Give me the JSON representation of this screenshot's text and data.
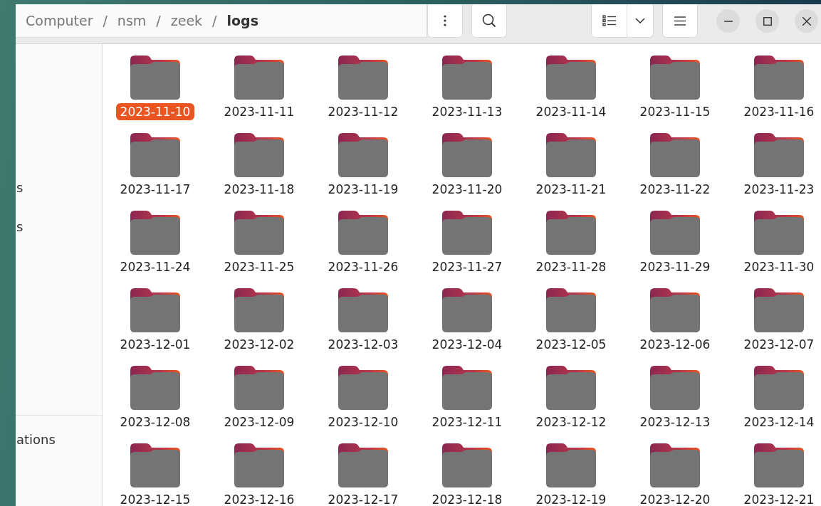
{
  "path": [
    {
      "label": "Computer",
      "current": false
    },
    {
      "label": "nsm",
      "current": false
    },
    {
      "label": "zeek",
      "current": false
    },
    {
      "label": "logs",
      "current": true
    }
  ],
  "path_separator": "/",
  "sidebar": {
    "items": [
      {
        "label": "s"
      },
      {
        "label": "s"
      }
    ],
    "other_items": [
      {
        "label": "ations"
      }
    ]
  },
  "folders": [
    {
      "name": "2023-11-10",
      "selected": true
    },
    {
      "name": "2023-11-11",
      "selected": false
    },
    {
      "name": "2023-11-12",
      "selected": false
    },
    {
      "name": "2023-11-13",
      "selected": false
    },
    {
      "name": "2023-11-14",
      "selected": false
    },
    {
      "name": "2023-11-15",
      "selected": false
    },
    {
      "name": "2023-11-16",
      "selected": false
    },
    {
      "name": "2023-11-17",
      "selected": false
    },
    {
      "name": "2023-11-18",
      "selected": false
    },
    {
      "name": "2023-11-19",
      "selected": false
    },
    {
      "name": "2023-11-20",
      "selected": false
    },
    {
      "name": "2023-11-21",
      "selected": false
    },
    {
      "name": "2023-11-22",
      "selected": false
    },
    {
      "name": "2023-11-23",
      "selected": false
    },
    {
      "name": "2023-11-24",
      "selected": false
    },
    {
      "name": "2023-11-25",
      "selected": false
    },
    {
      "name": "2023-11-26",
      "selected": false
    },
    {
      "name": "2023-11-27",
      "selected": false
    },
    {
      "name": "2023-11-28",
      "selected": false
    },
    {
      "name": "2023-11-29",
      "selected": false
    },
    {
      "name": "2023-11-30",
      "selected": false
    },
    {
      "name": "2023-12-01",
      "selected": false
    },
    {
      "name": "2023-12-02",
      "selected": false
    },
    {
      "name": "2023-12-03",
      "selected": false
    },
    {
      "name": "2023-12-04",
      "selected": false
    },
    {
      "name": "2023-12-05",
      "selected": false
    },
    {
      "name": "2023-12-06",
      "selected": false
    },
    {
      "name": "2023-12-07",
      "selected": false
    },
    {
      "name": "2023-12-08",
      "selected": false
    },
    {
      "name": "2023-12-09",
      "selected": false
    },
    {
      "name": "2023-12-10",
      "selected": false
    },
    {
      "name": "2023-12-11",
      "selected": false
    },
    {
      "name": "2023-12-12",
      "selected": false
    },
    {
      "name": "2023-12-13",
      "selected": false
    },
    {
      "name": "2023-12-14",
      "selected": false
    },
    {
      "name": "2023-12-15",
      "selected": false
    },
    {
      "name": "2023-12-16",
      "selected": false
    },
    {
      "name": "2023-12-17",
      "selected": false
    },
    {
      "name": "2023-12-18",
      "selected": false
    },
    {
      "name": "2023-12-19",
      "selected": false
    },
    {
      "name": "2023-12-20",
      "selected": false
    },
    {
      "name": "2023-12-21",
      "selected": false
    }
  ]
}
